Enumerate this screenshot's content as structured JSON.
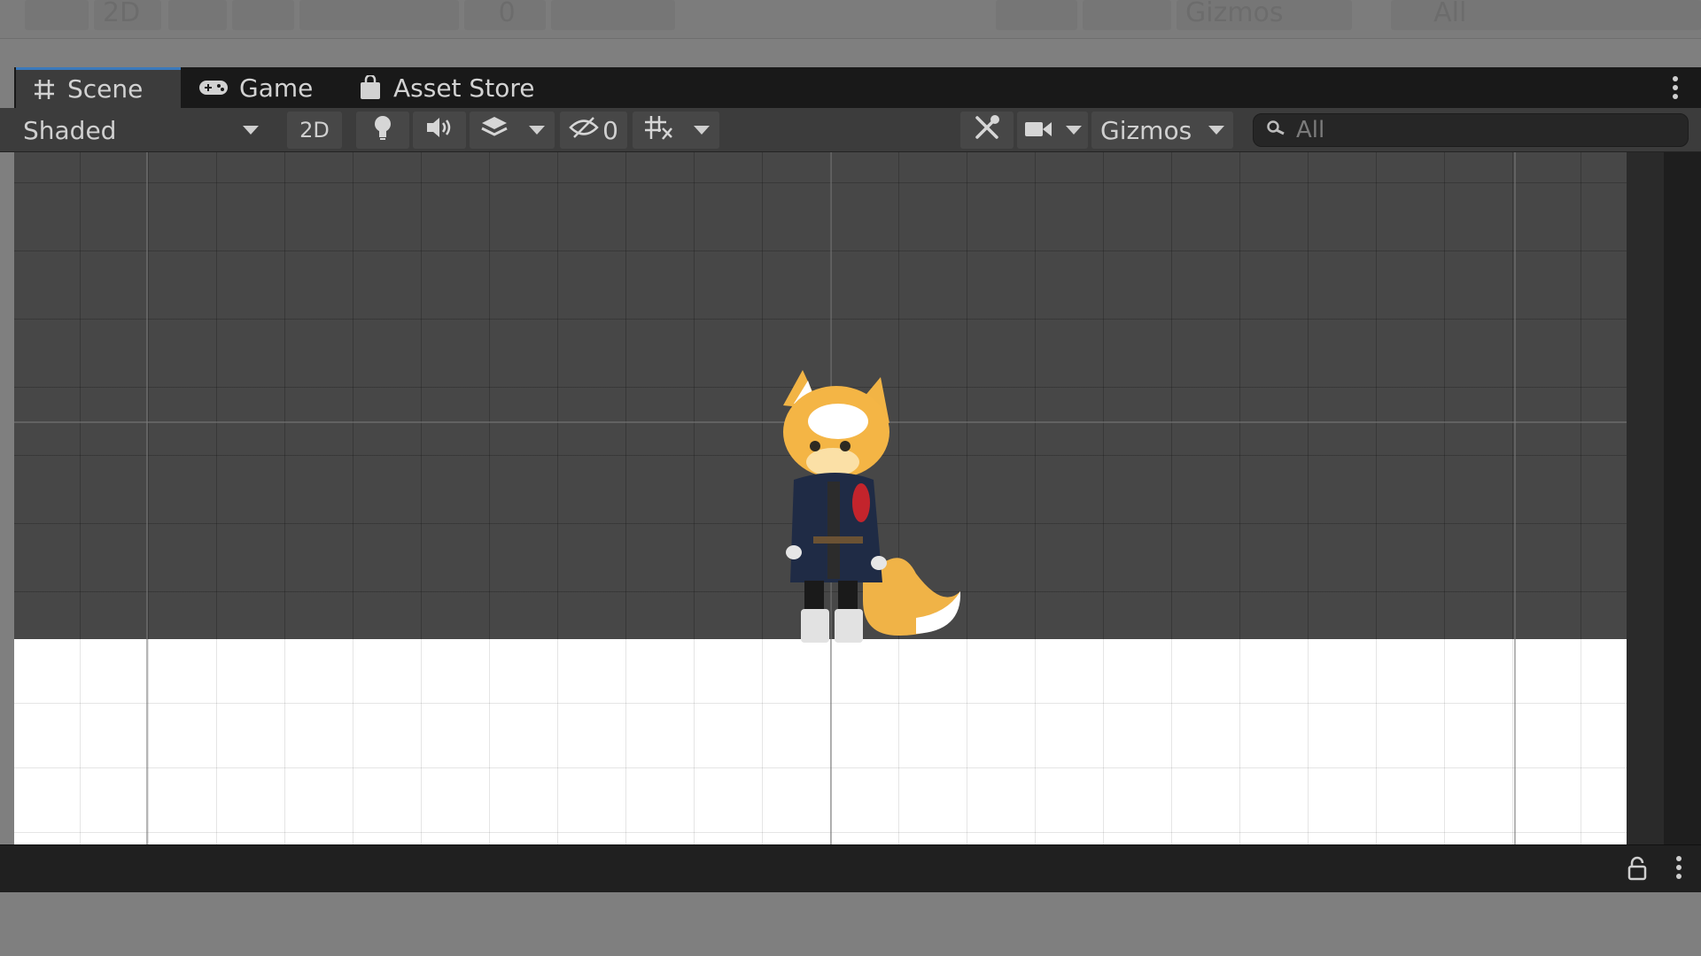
{
  "ghost_toolbar": {
    "twod": "2D",
    "hidden_count": "0",
    "gizmos": "Gizmos",
    "search": "All"
  },
  "tabs": [
    {
      "label": "Scene",
      "icon": "grid-hash-icon",
      "active": true
    },
    {
      "label": "Game",
      "icon": "gamepad-icon",
      "active": false
    },
    {
      "label": "Asset Store",
      "icon": "shopping-bag-icon",
      "active": false
    }
  ],
  "toolbar": {
    "draw_mode": "Shaded",
    "twod_label": "2D",
    "hidden_count": "0",
    "gizmos_label": "Gizmos",
    "search_placeholder": "All"
  },
  "colors": {
    "active_tab_accent": "#3a79bb",
    "viewport_grid": "#474747",
    "ground": "#ffffff"
  },
  "scene": {
    "sprite": "fox-character-sprite"
  }
}
